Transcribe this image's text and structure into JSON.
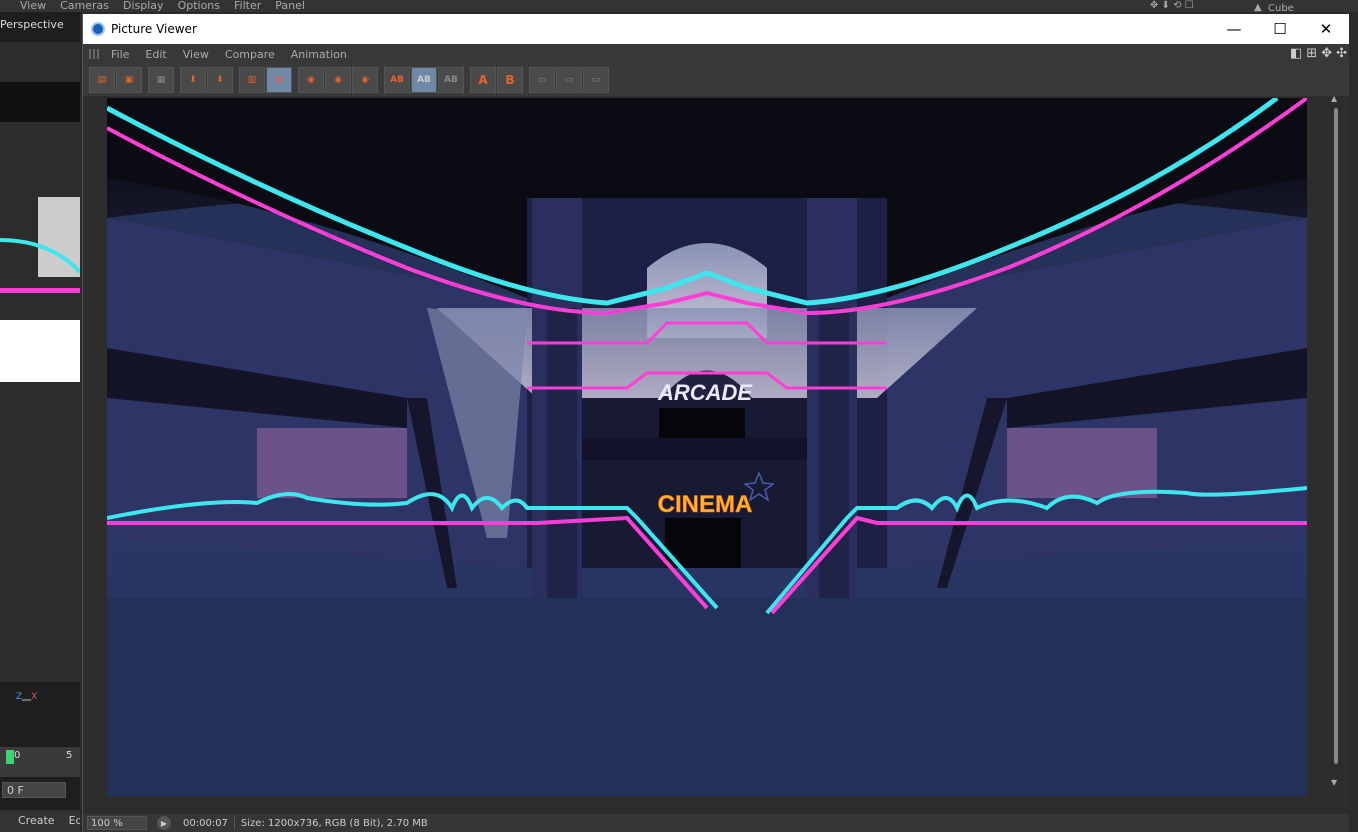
{
  "background_app": {
    "menu": [
      "View",
      "Cameras",
      "Display",
      "Options",
      "Filter",
      "Panel"
    ],
    "viewport_label": "Perspective",
    "object_label": "Cube",
    "timeline_start": "0",
    "timeline_tick": "5",
    "frame_field": "0 F",
    "bottom_menu": [
      "Create",
      "Ed"
    ]
  },
  "window": {
    "title": "Picture Viewer",
    "minimize": "—",
    "maximize": "☐",
    "close": "✕"
  },
  "menu": [
    "File",
    "Edit",
    "View",
    "Compare",
    "Animation"
  ],
  "toolbar": {
    "ab_labels": [
      "AB",
      "AB",
      "AB"
    ],
    "a_label": "A",
    "b_label": "B"
  },
  "render": {
    "sign_arcade": "ARCADE",
    "sign_cinema": "CINEMA",
    "colors": {
      "cyan": "#3ee6ee",
      "magenta": "#ff3ed8",
      "navy": "#243055",
      "dark": "#0d0d18",
      "cinema": "#ffb432"
    }
  },
  "status": {
    "zoom": "100 %",
    "time": "00:00:07",
    "info": "Size: 1200x736, RGB (8 Bit), 2.70 MB"
  }
}
